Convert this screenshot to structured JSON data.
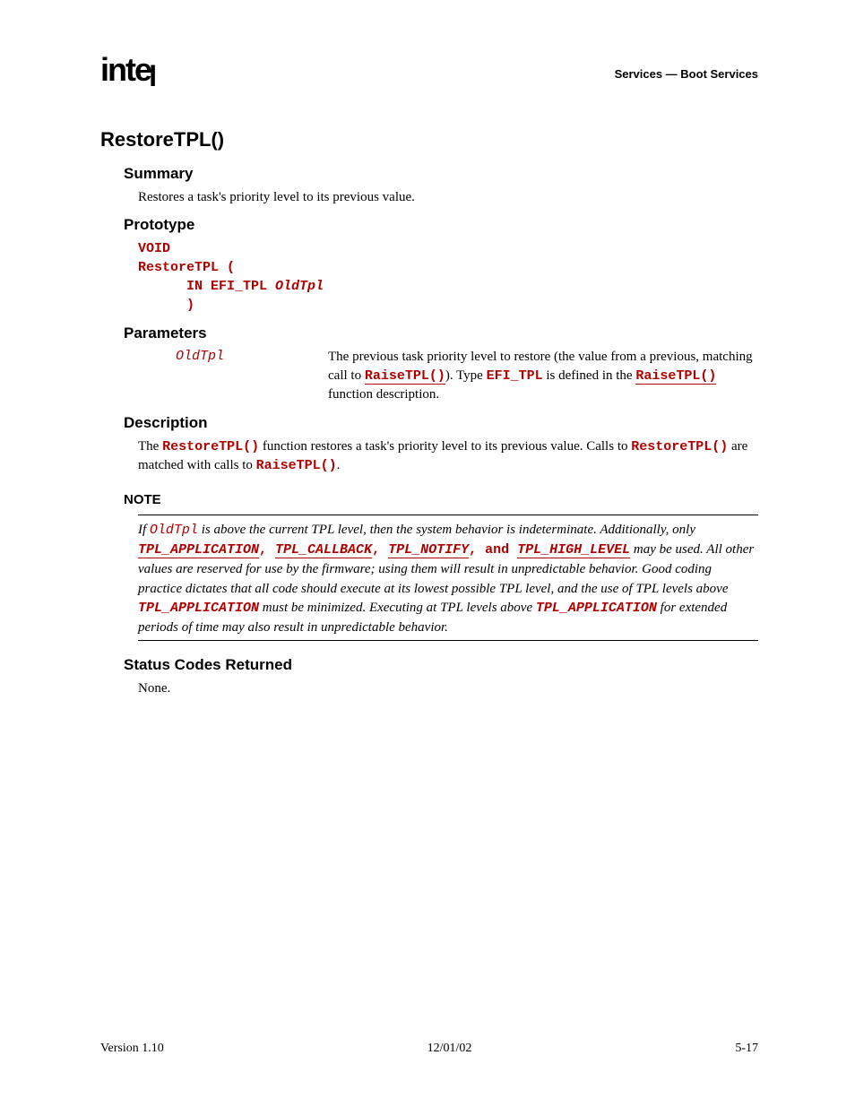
{
  "header": {
    "logo": "intel",
    "right": "Services — Boot Services"
  },
  "title": "RestoreTPL()",
  "sections": {
    "summary": {
      "heading": "Summary",
      "text": "Restores a task's priority level to its previous value."
    },
    "prototype": {
      "heading": "Prototype",
      "l1": "VOID",
      "l2": "RestoreTPL (",
      "l3kw": "      IN EFI_TPL ",
      "l3param": "OldTpl",
      "l4": "      )"
    },
    "parameters": {
      "heading": "Parameters",
      "name": "OldTpl",
      "desc_a": "The previous task priority level to restore (the value from a previous, matching call to ",
      "desc_link1": "RaiseTPL()",
      "desc_b": ").  Type ",
      "desc_code": "EFI_TPL",
      "desc_c": " is defined in the ",
      "desc_link2": "RaiseTPL()",
      "desc_d": " function description."
    },
    "description": {
      "heading": "Description",
      "a": "The ",
      "code1": "RestoreTPL()",
      "b": " function restores a task's priority level to its previous value.  Calls to ",
      "code2": "RestoreTPL()",
      "c": " are matched with calls to ",
      "code3": "RaiseTPL()",
      "d": "."
    },
    "note": {
      "label": "NOTE",
      "a": "If ",
      "p": "OldTpl",
      "b": " is above the current TPL level, then the system behavior is indeterminate.  Additionally, only ",
      "c1": "TPL_APPLICATION",
      "s1": ", ",
      "c2": "TPL_CALLBACK",
      "s2": ", ",
      "c3": "TPL_NOTIFY",
      "s3": ", and ",
      "c4": "TPL_HIGH_LEVEL",
      "rest1": " may be used.  All other values are reserved for use by the firmware; using them will result in unpredictable behavior.  Good coding practice dictates that all code should execute at its lowest possible TPL level, and the use of TPL levels above ",
      "c5": "TPL_APPLICATION",
      "rest2": " must be minimized.  Executing at TPL levels above ",
      "c6": "TPL_APPLICATION",
      "rest3": " for extended periods of time may also result in unpredictable behavior."
    },
    "status": {
      "heading": "Status Codes Returned",
      "text": "None."
    }
  },
  "footer": {
    "left": "Version 1.10",
    "center": "12/01/02",
    "right": "5-17"
  }
}
